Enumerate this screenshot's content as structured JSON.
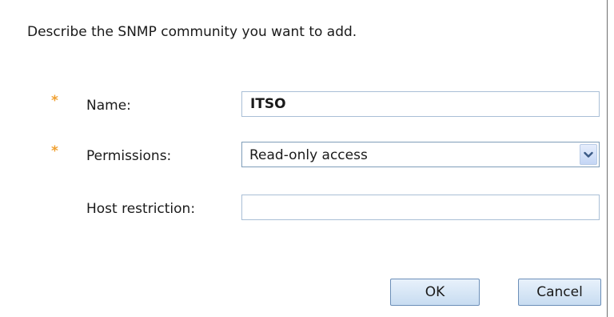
{
  "dialog": {
    "description": "Describe the SNMP community you want to add.",
    "accent_color": "#f0a030",
    "fields": {
      "name": {
        "required_marker": "*",
        "label": "Name:",
        "value": "ITSO",
        "placeholder": ""
      },
      "permissions": {
        "required_marker": "*",
        "label": "Permissions:",
        "selected": "Read-only access",
        "icon": "chevron-down-icon"
      },
      "host_restriction": {
        "label": "Host restriction:",
        "value": "",
        "placeholder": ""
      }
    },
    "buttons": {
      "ok_label": "OK",
      "cancel_label": "Cancel"
    }
  }
}
